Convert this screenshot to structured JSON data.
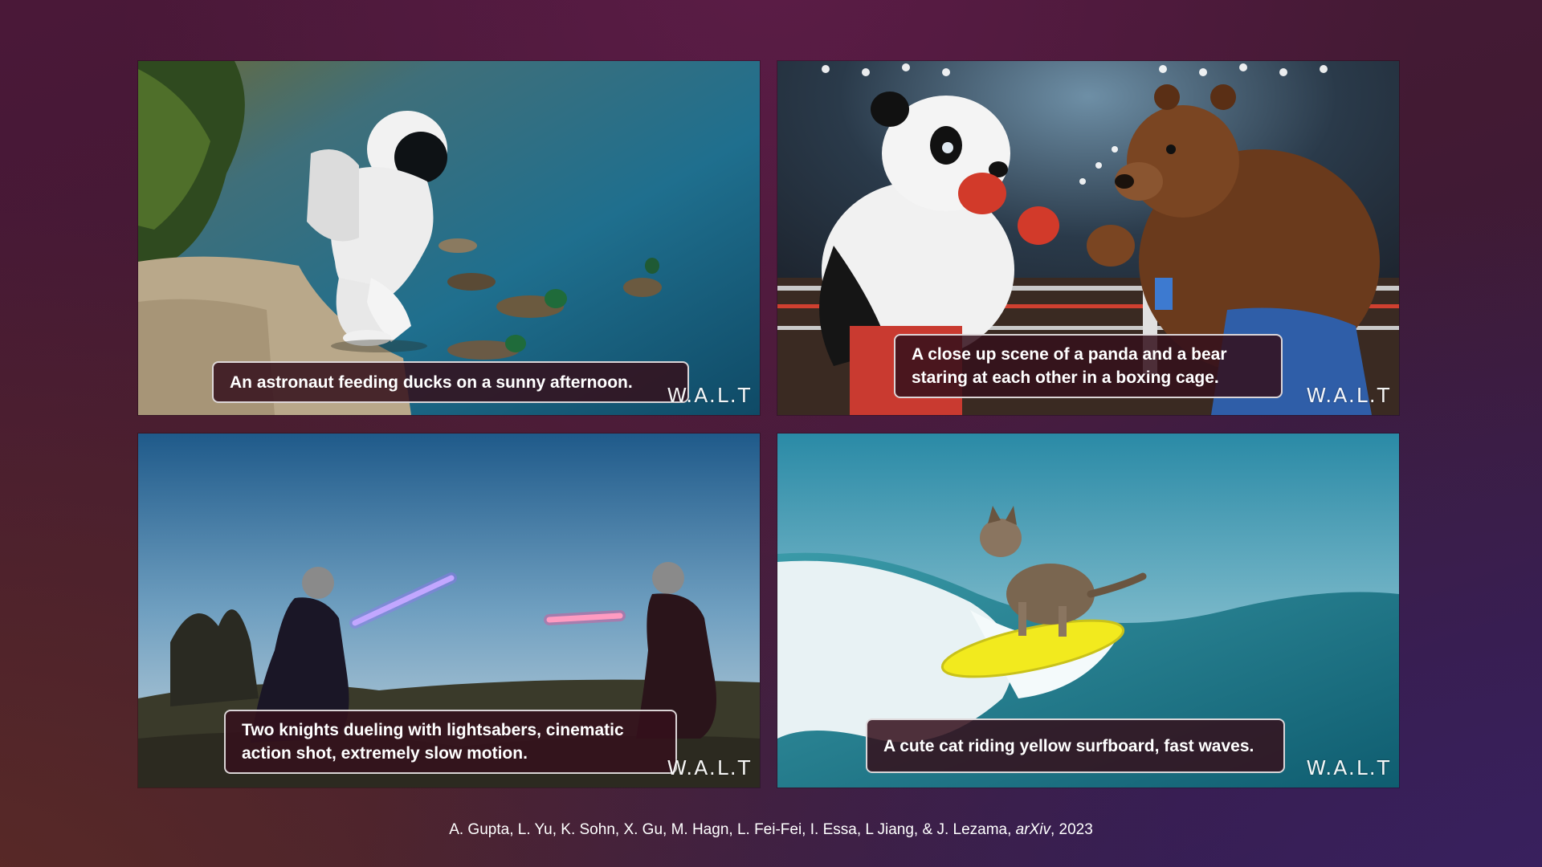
{
  "panels": [
    {
      "id": "p1",
      "caption": "An astronaut feeding ducks on a sunny afternoon.",
      "watermark": "W.A.L.T"
    },
    {
      "id": "p2",
      "caption": "A close up scene of a panda and a bear staring at each other in a boxing cage.",
      "watermark": "W.A.L.T"
    },
    {
      "id": "p3",
      "caption": "Two knights dueling with lightsabers, cinematic action shot, extremely slow motion.",
      "watermark": "W.A.L.T"
    },
    {
      "id": "p4",
      "caption": "A cute cat riding yellow surfboard, fast waves.",
      "watermark": "W.A.L.T"
    }
  ],
  "citation": {
    "authors": "A. Gupta, L. Yu, K. Sohn, X. Gu, M. Hagn, L. Fei-Fei, I. Essa, L Jiang, & J. Lezama,",
    "venue": "arXiv",
    "year": ", 2023"
  },
  "colors": {
    "background": "#421a33",
    "caption_fill": "#34101c",
    "caption_border": "#ffffff",
    "lightsaber_left": "#9b6bff",
    "lightsaber_right": "#ff3a8a",
    "surfboard": "#f2ea1e"
  },
  "icons": [
    "walt-watermark"
  ]
}
